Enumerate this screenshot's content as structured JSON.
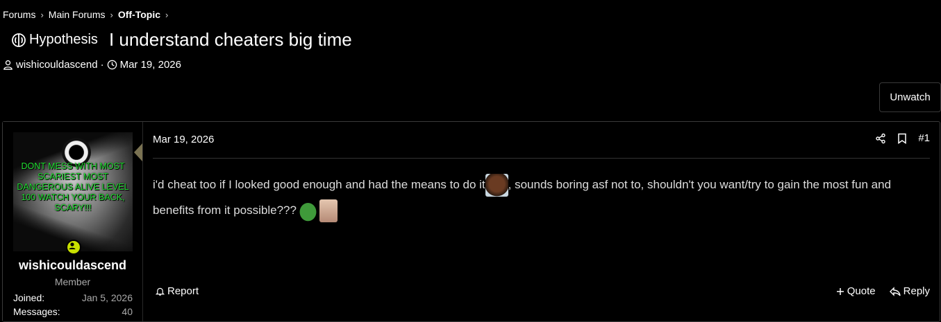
{
  "breadcrumb": {
    "items": [
      "Forums",
      "Main Forums",
      "Off-Topic"
    ]
  },
  "thread": {
    "prefix": "Hypothesis",
    "title": "I understand cheaters big time",
    "author": "wishicouldascend",
    "date": "Mar 19, 2026",
    "unwatch_label": "Unwatch"
  },
  "post": {
    "user": {
      "name": "wishicouldascend",
      "role": "Member",
      "avatar_caption": "DONT MESS WITH MOST SCARIEST MOST DANGEROUS ALIVE LEVEL 100 WATCH YOUR BACK, SCARY!!!",
      "stats": [
        {
          "label": "Joined:",
          "value": "Jan 5, 2026"
        },
        {
          "label": "Messages:",
          "value": "40"
        }
      ]
    },
    "date": "Mar 19, 2026",
    "number": "#1",
    "body_part1": "i'd cheat too if I looked good enough and had the means to do it",
    "body_part2": ", sounds boring asf not to, shouldn't you want/try to gain the most fun and benefits from it possible???",
    "report_label": "Report",
    "quote_label": "Quote",
    "reply_label": "Reply"
  },
  "colors": {
    "background": "#000000",
    "online_indicator": "#c8e000",
    "avatar_text": "#22dd33"
  }
}
